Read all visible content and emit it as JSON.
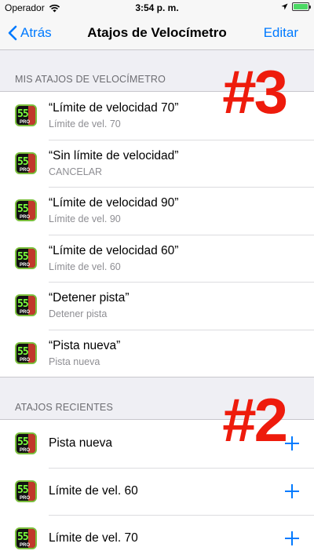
{
  "status_bar": {
    "carrier": "Operador",
    "time": "3:54 p. m.",
    "icons": {
      "wifi": "wifi-icon",
      "location": "location-arrow-icon",
      "battery": "battery-icon"
    },
    "battery_color": "#4cd964"
  },
  "nav": {
    "back_label": "Atrás",
    "title": "Atajos de Velocímetro",
    "edit_label": "Editar",
    "accent": "#007aff"
  },
  "annotations": {
    "section1_number": "#3",
    "section2_number": "#2",
    "color": "#ee1b0c"
  },
  "app_icon": {
    "digits": "55",
    "badge": "PRO"
  },
  "my_shortcuts": {
    "header": "MIS ATAJOS DE VELOCÍMETRO",
    "items": [
      {
        "title": "“Límite de velocidad 70”",
        "subtitle": "Límite de vel. 70"
      },
      {
        "title": "“Sin límite de velocidad”",
        "subtitle": "CANCELAR"
      },
      {
        "title": "“Límite de velocidad 90”",
        "subtitle": "Límite de vel. 90"
      },
      {
        "title": "“Límite de velocidad 60”",
        "subtitle": "Límite de vel. 60"
      },
      {
        "title": "“Detener pista”",
        "subtitle": "Detener pista"
      },
      {
        "title": "“Pista nueva”",
        "subtitle": "Pista nueva"
      }
    ]
  },
  "recent_shortcuts": {
    "header": "ATAJOS RECIENTES",
    "items": [
      {
        "title": "Pista nueva"
      },
      {
        "title": "Límite de vel. 60"
      },
      {
        "title": "Límite de vel. 70"
      }
    ]
  }
}
